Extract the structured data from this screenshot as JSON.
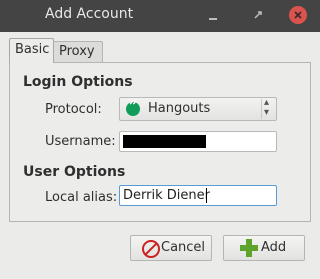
{
  "window": {
    "title": "Add Account",
    "titlebar_color": "#444444",
    "close_color": "#d9534f"
  },
  "tabs": [
    {
      "label": "Basic",
      "active": true
    },
    {
      "label": "Proxy",
      "active": false
    }
  ],
  "login_options": {
    "heading": "Login Options",
    "protocol_label": "Protocol:",
    "protocol_value": "Hangouts",
    "protocol_icon": "hangouts-icon",
    "username_label": "Username:",
    "username_value": ""
  },
  "user_options": {
    "heading": "User Options",
    "alias_label": "Local alias:",
    "alias_value": "Derrik Diener"
  },
  "buttons": {
    "cancel_label": "Cancel",
    "add_label": "Add",
    "cancel_icon": "cancel-icon",
    "add_icon": "add-icon"
  }
}
